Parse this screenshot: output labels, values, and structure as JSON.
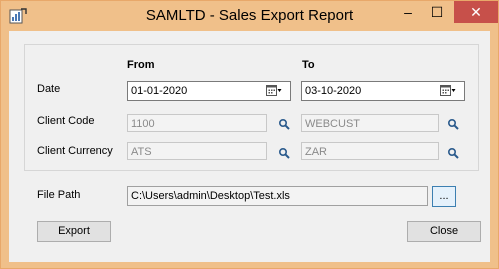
{
  "window": {
    "title": "SAMLTD - Sales Export Report",
    "controls": {
      "minimize": "–",
      "maximize": "☐",
      "close": "✕"
    }
  },
  "form": {
    "headers": {
      "from": "From",
      "to": "To"
    },
    "date": {
      "label": "Date",
      "from": "01-01-2020",
      "to": "03-10-2020"
    },
    "client_code": {
      "label": "Client Code",
      "from": "1100",
      "to": "WEBCUST"
    },
    "client_currency": {
      "label": "Client Currency",
      "from": "ATS",
      "to": "ZAR"
    },
    "file_path": {
      "label": "File Path",
      "value": "C:\\Users\\admin\\Desktop\\Test.xls",
      "browse_label": "..."
    }
  },
  "buttons": {
    "export": "Export",
    "close": "Close"
  }
}
